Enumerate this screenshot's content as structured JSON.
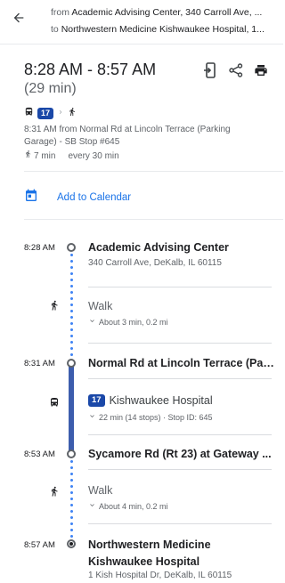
{
  "header": {
    "from_prefix": "from",
    "from_value": "Academic Advising Center, 340 Carroll Ave, ...",
    "to_prefix": "to",
    "to_value": "Northwestern Medicine Kishwaukee Hospital, 1..."
  },
  "summary": {
    "time_range": "8:28 AM - 8:57 AM",
    "duration": "(29 min)",
    "mode_route": "17",
    "departure_detail": "8:31 AM from Normal Rd at Lincoln Terrace (Parking",
    "departure_detail_2": "Garage) - SB Stop #645",
    "walk_total": "7 min",
    "frequency": "every 30 min"
  },
  "actions": {
    "add_to_calendar": "Add to Calendar"
  },
  "timeline": {
    "stop1": {
      "time": "8:28 AM",
      "name": "Academic Advising Center",
      "address": "340 Carroll Ave, DeKalb, IL 60115"
    },
    "walk1": {
      "title": "Walk",
      "detail": "About 3 min, 0.2 mi"
    },
    "stop2": {
      "time": "8:31 AM",
      "name": "Normal Rd at Lincoln Terrace (Par..."
    },
    "transit": {
      "route": "17",
      "headsign": "Kishwaukee Hospital",
      "detail": "22 min (14 stops) · Stop ID: 645"
    },
    "stop3": {
      "time": "8:53 AM",
      "name": "Sycamore Rd (Rt 23) at Gateway ..."
    },
    "walk2": {
      "title": "Walk",
      "detail": "About 4 min, 0.2 mi"
    },
    "stop4": {
      "time": "8:57 AM",
      "name_line1": "Northwestern Medicine",
      "name_line2": "Kishwaukee Hospital",
      "address": "1 Kish Hospital Dr, DeKalb, IL 60115"
    }
  },
  "colors": {
    "accent": "#1a73e8",
    "transit_route": "#1a48a8",
    "transit_bar": "#3c5dad",
    "walk_dots": "#4285f4"
  },
  "icons": [
    "back-arrow-icon",
    "mobile-send-icon",
    "share-icon",
    "print-icon",
    "bus-icon",
    "walk-icon",
    "calendar-icon",
    "chevron-right-icon",
    "chevron-down-icon"
  ]
}
